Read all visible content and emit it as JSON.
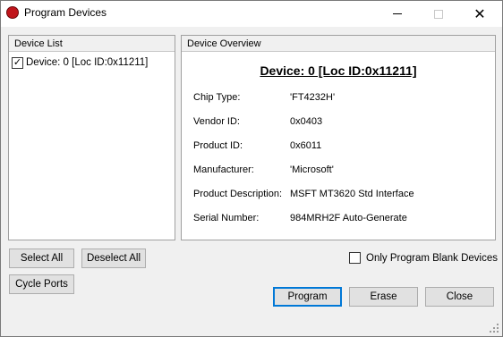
{
  "window": {
    "title": "Program Devices",
    "close_glyph": "✕"
  },
  "device_list": {
    "header": "Device List",
    "items": [
      {
        "label": "Device: 0 [Loc ID:0x11211]",
        "checked": true
      }
    ]
  },
  "device_overview": {
    "header": "Device Overview",
    "title": "Device: 0 [Loc ID:0x11211]",
    "fields": [
      {
        "label": "Chip Type:",
        "value": "'FT4232H'"
      },
      {
        "label": "Vendor ID:",
        "value": "0x0403"
      },
      {
        "label": "Product ID:",
        "value": "0x6011"
      },
      {
        "label": "Manufacturer:",
        "value": "'Microsoft'"
      },
      {
        "label": "Product Description:",
        "value": "MSFT MT3620 Std Interface"
      },
      {
        "label": "Serial Number:",
        "value": "984MRH2F Auto-Generate"
      }
    ]
  },
  "buttons": {
    "select_all": "Select All",
    "deselect_all": "Deselect All",
    "cycle_ports": "Cycle Ports",
    "program": "Program",
    "erase": "Erase",
    "close": "Close"
  },
  "options": {
    "only_program_blank_label": "Only Program Blank Devices",
    "only_program_blank_checked": false
  },
  "colors": {
    "app_icon": "#c0141a",
    "focus_border": "#0078d7"
  },
  "icons": {
    "app": "app-icon",
    "checkmark": "check-icon"
  }
}
